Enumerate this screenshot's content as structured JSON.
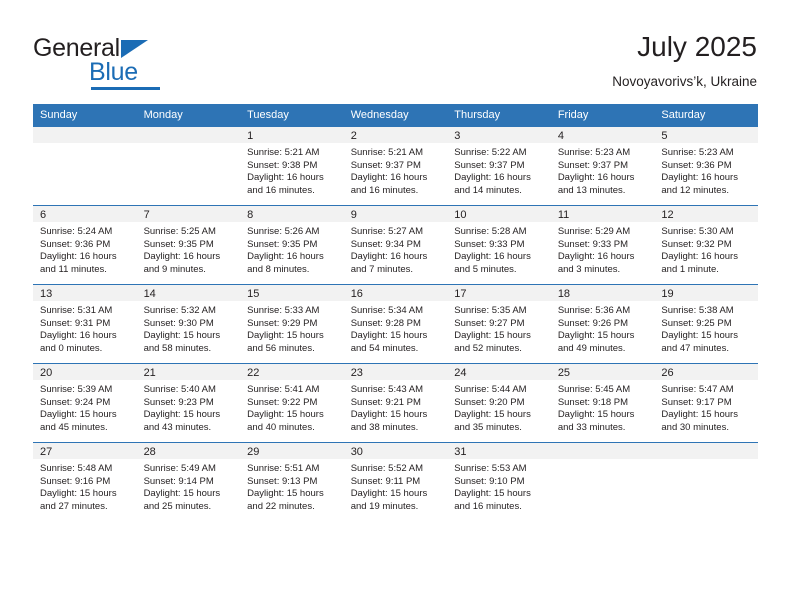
{
  "logo": {
    "word_top": "General",
    "word_bottom": "Blue",
    "triangle_icon": "triangle-icon",
    "accent_color": "#1b6cb5"
  },
  "header": {
    "title": "July 2025",
    "subtitle": "Novoyavorivs’k, Ukraine"
  },
  "calendar": {
    "header_color": "#2e74b5",
    "daynum_band_color": "#f2f2f2",
    "weekdays": [
      "Sunday",
      "Monday",
      "Tuesday",
      "Wednesday",
      "Thursday",
      "Friday",
      "Saturday"
    ],
    "weeks": [
      [
        {
          "day": "",
          "lines": []
        },
        {
          "day": "",
          "lines": []
        },
        {
          "day": "1",
          "lines": [
            "Sunrise: 5:21 AM",
            "Sunset: 9:38 PM",
            "Daylight: 16 hours",
            "and 16 minutes."
          ]
        },
        {
          "day": "2",
          "lines": [
            "Sunrise: 5:21 AM",
            "Sunset: 9:37 PM",
            "Daylight: 16 hours",
            "and 16 minutes."
          ]
        },
        {
          "day": "3",
          "lines": [
            "Sunrise: 5:22 AM",
            "Sunset: 9:37 PM",
            "Daylight: 16 hours",
            "and 14 minutes."
          ]
        },
        {
          "day": "4",
          "lines": [
            "Sunrise: 5:23 AM",
            "Sunset: 9:37 PM",
            "Daylight: 16 hours",
            "and 13 minutes."
          ]
        },
        {
          "day": "5",
          "lines": [
            "Sunrise: 5:23 AM",
            "Sunset: 9:36 PM",
            "Daylight: 16 hours",
            "and 12 minutes."
          ]
        }
      ],
      [
        {
          "day": "6",
          "lines": [
            "Sunrise: 5:24 AM",
            "Sunset: 9:36 PM",
            "Daylight: 16 hours",
            "and 11 minutes."
          ]
        },
        {
          "day": "7",
          "lines": [
            "Sunrise: 5:25 AM",
            "Sunset: 9:35 PM",
            "Daylight: 16 hours",
            "and 9 minutes."
          ]
        },
        {
          "day": "8",
          "lines": [
            "Sunrise: 5:26 AM",
            "Sunset: 9:35 PM",
            "Daylight: 16 hours",
            "and 8 minutes."
          ]
        },
        {
          "day": "9",
          "lines": [
            "Sunrise: 5:27 AM",
            "Sunset: 9:34 PM",
            "Daylight: 16 hours",
            "and 7 minutes."
          ]
        },
        {
          "day": "10",
          "lines": [
            "Sunrise: 5:28 AM",
            "Sunset: 9:33 PM",
            "Daylight: 16 hours",
            "and 5 minutes."
          ]
        },
        {
          "day": "11",
          "lines": [
            "Sunrise: 5:29 AM",
            "Sunset: 9:33 PM",
            "Daylight: 16 hours",
            "and 3 minutes."
          ]
        },
        {
          "day": "12",
          "lines": [
            "Sunrise: 5:30 AM",
            "Sunset: 9:32 PM",
            "Daylight: 16 hours",
            "and 1 minute."
          ]
        }
      ],
      [
        {
          "day": "13",
          "lines": [
            "Sunrise: 5:31 AM",
            "Sunset: 9:31 PM",
            "Daylight: 16 hours",
            "and 0 minutes."
          ]
        },
        {
          "day": "14",
          "lines": [
            "Sunrise: 5:32 AM",
            "Sunset: 9:30 PM",
            "Daylight: 15 hours",
            "and 58 minutes."
          ]
        },
        {
          "day": "15",
          "lines": [
            "Sunrise: 5:33 AM",
            "Sunset: 9:29 PM",
            "Daylight: 15 hours",
            "and 56 minutes."
          ]
        },
        {
          "day": "16",
          "lines": [
            "Sunrise: 5:34 AM",
            "Sunset: 9:28 PM",
            "Daylight: 15 hours",
            "and 54 minutes."
          ]
        },
        {
          "day": "17",
          "lines": [
            "Sunrise: 5:35 AM",
            "Sunset: 9:27 PM",
            "Daylight: 15 hours",
            "and 52 minutes."
          ]
        },
        {
          "day": "18",
          "lines": [
            "Sunrise: 5:36 AM",
            "Sunset: 9:26 PM",
            "Daylight: 15 hours",
            "and 49 minutes."
          ]
        },
        {
          "day": "19",
          "lines": [
            "Sunrise: 5:38 AM",
            "Sunset: 9:25 PM",
            "Daylight: 15 hours",
            "and 47 minutes."
          ]
        }
      ],
      [
        {
          "day": "20",
          "lines": [
            "Sunrise: 5:39 AM",
            "Sunset: 9:24 PM",
            "Daylight: 15 hours",
            "and 45 minutes."
          ]
        },
        {
          "day": "21",
          "lines": [
            "Sunrise: 5:40 AM",
            "Sunset: 9:23 PM",
            "Daylight: 15 hours",
            "and 43 minutes."
          ]
        },
        {
          "day": "22",
          "lines": [
            "Sunrise: 5:41 AM",
            "Sunset: 9:22 PM",
            "Daylight: 15 hours",
            "and 40 minutes."
          ]
        },
        {
          "day": "23",
          "lines": [
            "Sunrise: 5:43 AM",
            "Sunset: 9:21 PM",
            "Daylight: 15 hours",
            "and 38 minutes."
          ]
        },
        {
          "day": "24",
          "lines": [
            "Sunrise: 5:44 AM",
            "Sunset: 9:20 PM",
            "Daylight: 15 hours",
            "and 35 minutes."
          ]
        },
        {
          "day": "25",
          "lines": [
            "Sunrise: 5:45 AM",
            "Sunset: 9:18 PM",
            "Daylight: 15 hours",
            "and 33 minutes."
          ]
        },
        {
          "day": "26",
          "lines": [
            "Sunrise: 5:47 AM",
            "Sunset: 9:17 PM",
            "Daylight: 15 hours",
            "and 30 minutes."
          ]
        }
      ],
      [
        {
          "day": "27",
          "lines": [
            "Sunrise: 5:48 AM",
            "Sunset: 9:16 PM",
            "Daylight: 15 hours",
            "and 27 minutes."
          ]
        },
        {
          "day": "28",
          "lines": [
            "Sunrise: 5:49 AM",
            "Sunset: 9:14 PM",
            "Daylight: 15 hours",
            "and 25 minutes."
          ]
        },
        {
          "day": "29",
          "lines": [
            "Sunrise: 5:51 AM",
            "Sunset: 9:13 PM",
            "Daylight: 15 hours",
            "and 22 minutes."
          ]
        },
        {
          "day": "30",
          "lines": [
            "Sunrise: 5:52 AM",
            "Sunset: 9:11 PM",
            "Daylight: 15 hours",
            "and 19 minutes."
          ]
        },
        {
          "day": "31",
          "lines": [
            "Sunrise: 5:53 AM",
            "Sunset: 9:10 PM",
            "Daylight: 15 hours",
            "and 16 minutes."
          ]
        },
        {
          "day": "",
          "lines": []
        },
        {
          "day": "",
          "lines": []
        }
      ]
    ]
  }
}
